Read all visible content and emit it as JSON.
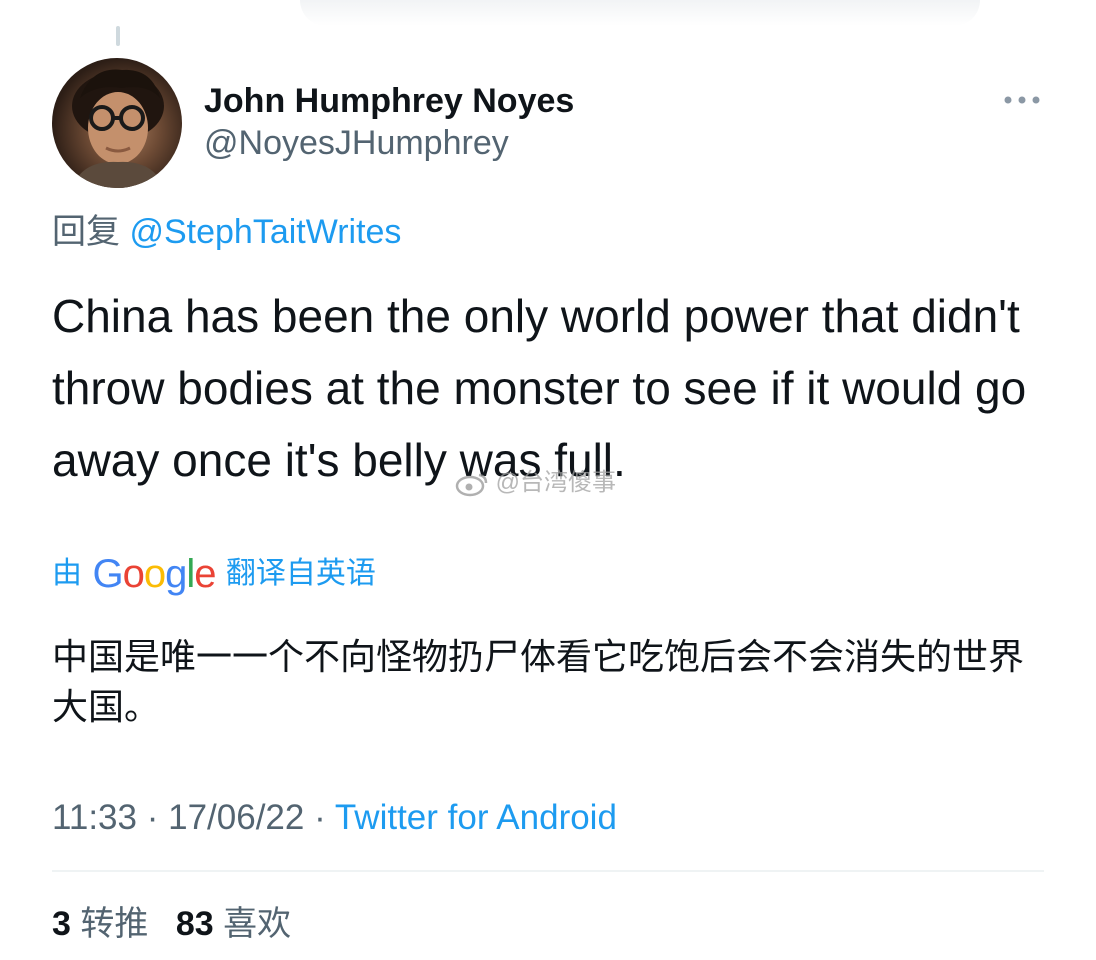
{
  "tweet": {
    "author": {
      "display_name": "John Humphrey Noyes",
      "handle": "@NoyesJHumphrey"
    },
    "reply": {
      "prefix": "回复",
      "to_handle": "@StephTaitWrites"
    },
    "text": "China has been the only world power that didn't throw bodies at the monster to see if it would go away once it's belly was full.",
    "watermark": "@台湾傻事",
    "translation": {
      "prefix": "由",
      "brand_letters": [
        "G",
        "o",
        "o",
        "g",
        "l",
        "e"
      ],
      "suffix": "翻译自英语",
      "text": "中国是唯一一个不向怪物扔尸体看它吃饱后会不会消失的世界大国。"
    },
    "meta": {
      "time": "11:33",
      "date": "17/06/22",
      "separator": "·",
      "source": "Twitter for Android"
    },
    "stats": {
      "retweets_count": "3",
      "retweets_label": "转推",
      "likes_count": "83",
      "likes_label": "喜欢"
    }
  },
  "icons": {
    "more": "more-options-icon",
    "avatar": "avatar"
  },
  "colors": {
    "text_primary": "#0f1419",
    "text_secondary": "#536471",
    "link": "#1d9bf0",
    "divider": "#eff3f4"
  }
}
